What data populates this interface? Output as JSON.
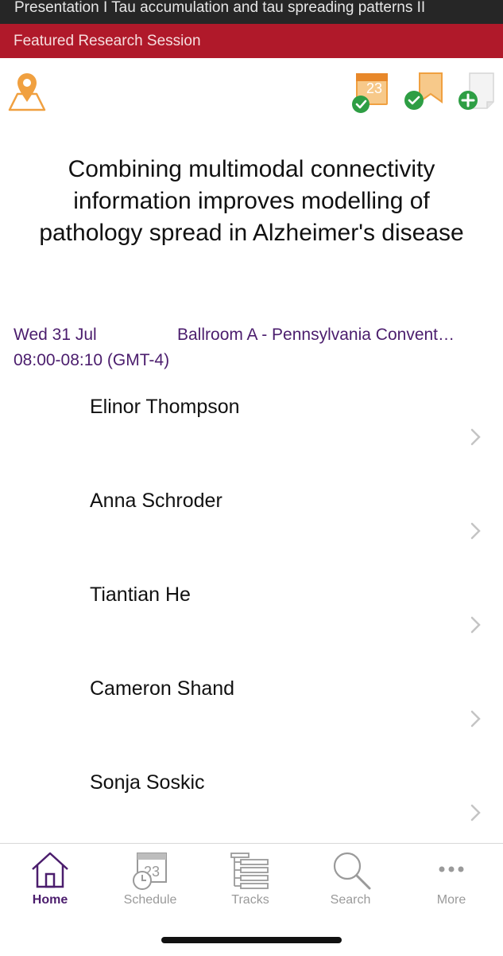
{
  "header": {
    "presentation_title": "Presentation I Tau accumulation and tau spreading patterns II",
    "session_type": "Featured Research Session"
  },
  "actions": {
    "map": "map-pin-icon",
    "calendar": "calendar-added-icon",
    "calendar_day": "23",
    "bookmark": "bookmark-added-icon",
    "note": "add-note-icon"
  },
  "abstract": {
    "title": "Combining multimodal connectivity information improves modelling of pathology spread in Alzheimer's disease"
  },
  "meta": {
    "date": "Wed 31 Jul",
    "venue": "Ballroom A - Pennsylvania Convent…",
    "time": "08:00-08:10 (GMT-4)"
  },
  "authors": [
    {
      "name": "Elinor Thompson"
    },
    {
      "name": "Anna Schroder"
    },
    {
      "name": "Tiantian He"
    },
    {
      "name": "Cameron Shand"
    },
    {
      "name": "Sonja Soskic"
    }
  ],
  "tabs": [
    {
      "label": "Home",
      "icon": "home-icon",
      "active": true
    },
    {
      "label": "Schedule",
      "icon": "schedule-icon",
      "active": false
    },
    {
      "label": "Tracks",
      "icon": "tracks-icon",
      "active": false
    },
    {
      "label": "Search",
      "icon": "search-icon",
      "active": false
    },
    {
      "label": "More",
      "icon": "more-icon",
      "active": false
    }
  ],
  "colors": {
    "session_bar": "#b0192a",
    "accent_purple": "#4b1d6d",
    "orange": "#f0a040",
    "check_green": "#2e9e44"
  }
}
